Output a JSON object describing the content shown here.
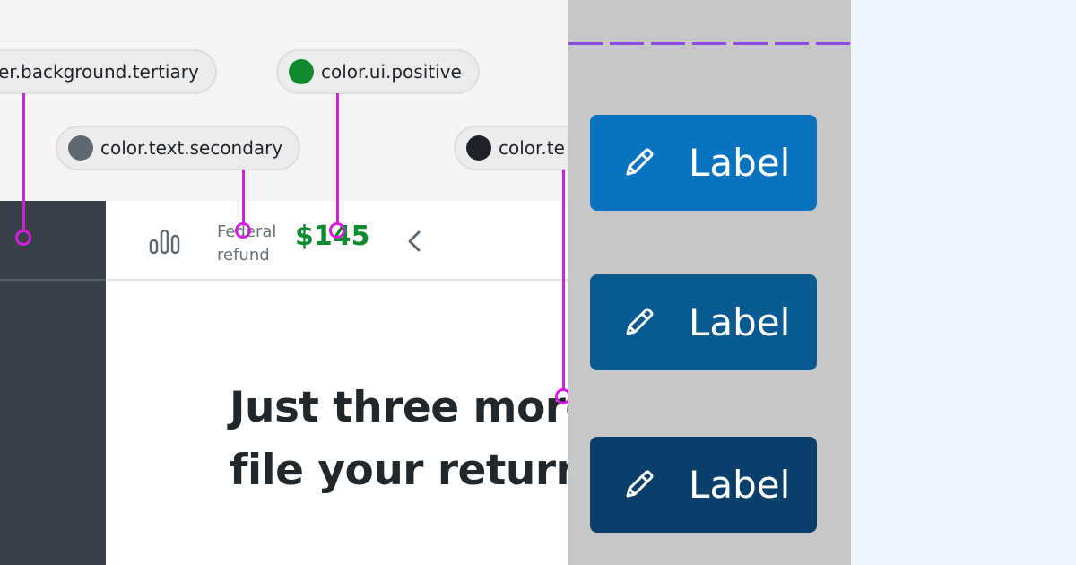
{
  "annotations": {
    "bg_tertiary": {
      "label": "er.background.tertiary"
    },
    "ui_positive": {
      "label": "color.ui.positive",
      "swatch": "#108a30"
    },
    "text_secondary": {
      "label": "color.text.secondary",
      "swatch": "#5f6870"
    },
    "text_primary": {
      "label": "color.te",
      "swatch": "#1f2328"
    }
  },
  "refund": {
    "label_line1": "Federal",
    "label_line2": "refund",
    "amount": "$145"
  },
  "heading": {
    "line1": "Just three more",
    "line2": "file your returns"
  },
  "buttons": [
    {
      "label": "Label",
      "color": "#0a73c0",
      "state": "default"
    },
    {
      "label": "Label",
      "color": "#0a5a92",
      "state": "hover"
    },
    {
      "label": "Label",
      "color": "#093f6a",
      "state": "pressed"
    }
  ],
  "colors": {
    "accent_magenta": "#d31ee0",
    "dash_purple": "#8a4ae6",
    "sidebar_bg": "#3a4047",
    "mid_bg": "#c7c7c7",
    "right_bg": "#eef5fc"
  },
  "icons": [
    "chart-bars-icon",
    "chevron-left-icon",
    "pencil-icon"
  ]
}
